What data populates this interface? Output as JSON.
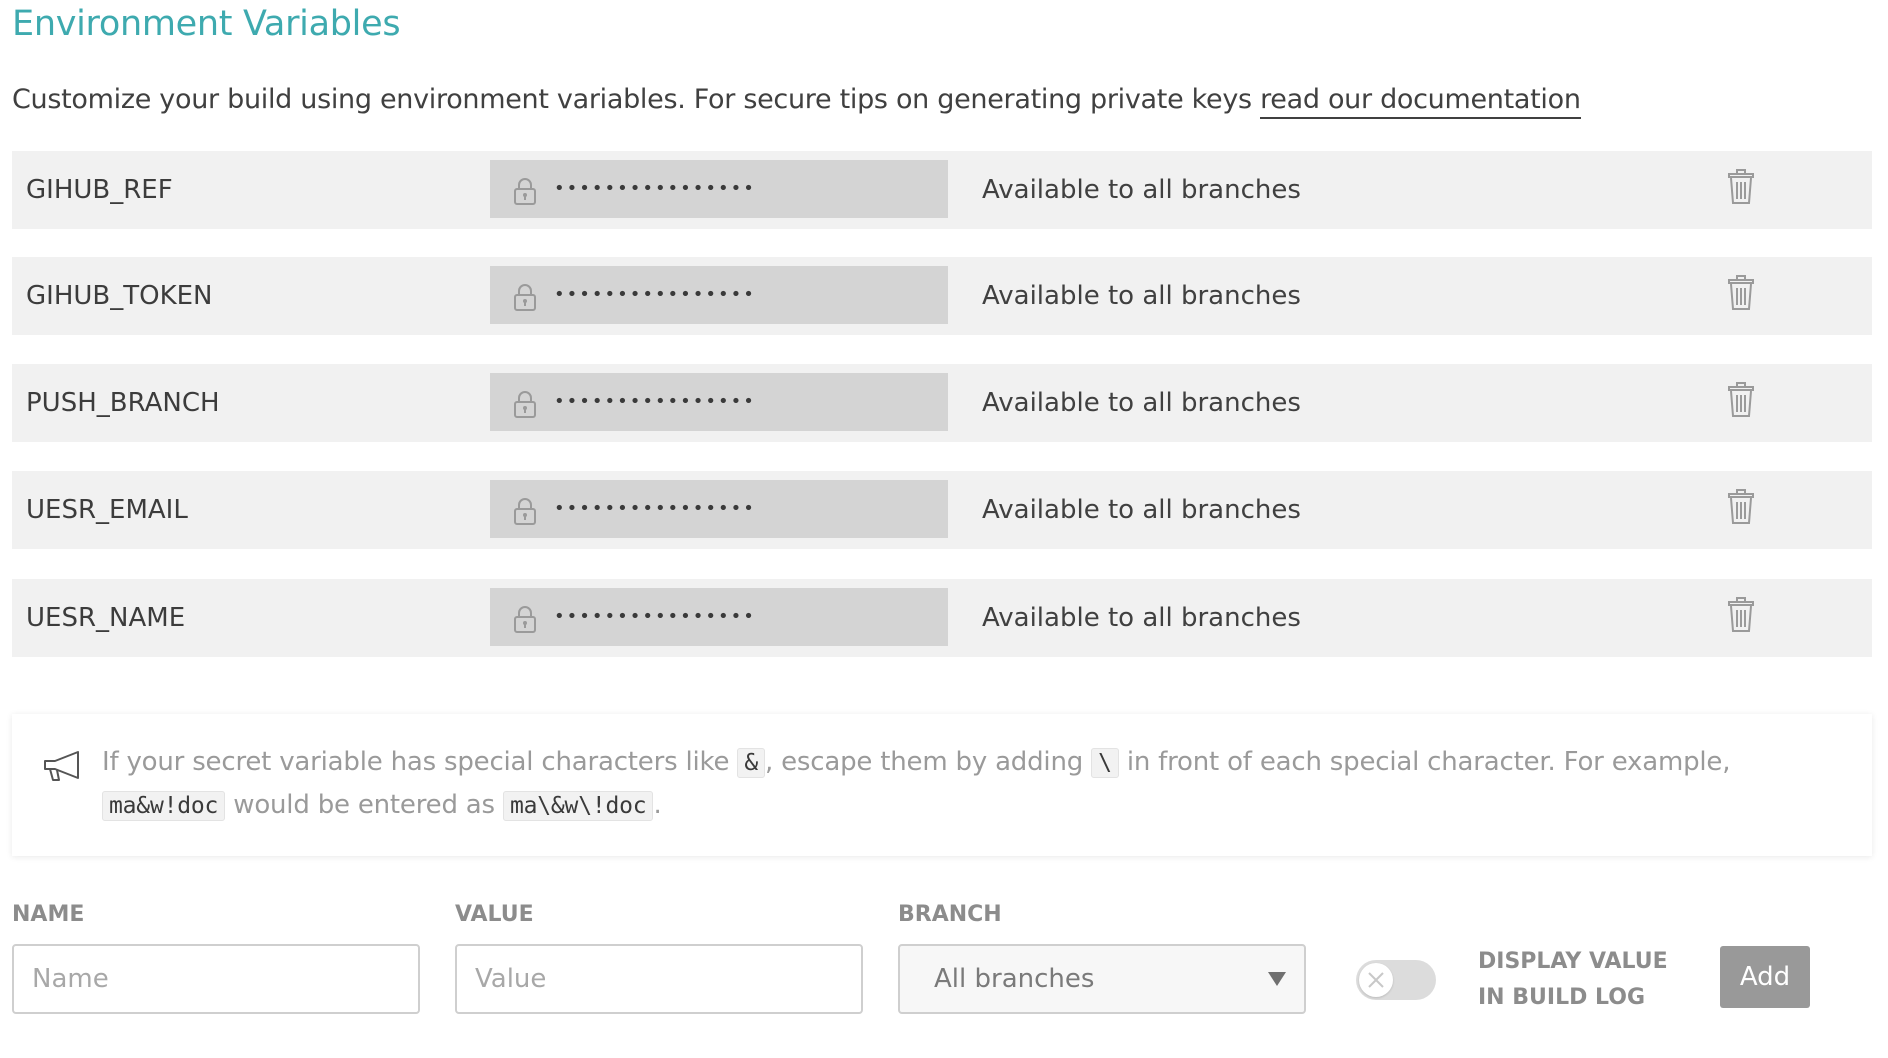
{
  "header": {
    "title": "Environment Variables",
    "intro": "Customize your build using environment variables. For secure tips on generating private keys ",
    "intro_link": "read our documentation"
  },
  "variables": [
    {
      "name": "GIHUB_REF",
      "value_mask": "••••••••••••••••",
      "scope": "Available to all branches"
    },
    {
      "name": "GIHUB_TOKEN",
      "value_mask": "••••••••••••••••",
      "scope": "Available to all branches"
    },
    {
      "name": "PUSH_BRANCH",
      "value_mask": "••••••••••••••••",
      "scope": "Available to all branches"
    },
    {
      "name": "UESR_EMAIL",
      "value_mask": "••••••••••••••••",
      "scope": "Available to all branches"
    },
    {
      "name": "UESR_NAME",
      "value_mask": "••••••••••••••••",
      "scope": "Available to all branches"
    }
  ],
  "note": {
    "icon": "megaphone-icon",
    "text_1": "If your secret variable has special characters like ",
    "code_1": "&",
    "text_2": ", escape them by adding ",
    "code_2": "\\",
    "text_3": " in front of each special character. For example, ",
    "code_3": "ma&w!doc",
    "text_4": " would be entered as ",
    "code_4": "ma\\&w\\!doc",
    "text_5": "."
  },
  "form": {
    "name_label": "NAME",
    "name_placeholder": "Name",
    "value_label": "VALUE",
    "value_placeholder": "Value",
    "branch_label": "BRANCH",
    "branch_selected": "All branches",
    "display_toggle_on": false,
    "display_label": "DISPLAY VALUE IN BUILD LOG",
    "add_label": "Add"
  },
  "colors": {
    "title": "#3eaaaf",
    "row_background": "#f1f1f1",
    "masked_value_background": "#d4d4d4",
    "add_button": "#999999"
  }
}
